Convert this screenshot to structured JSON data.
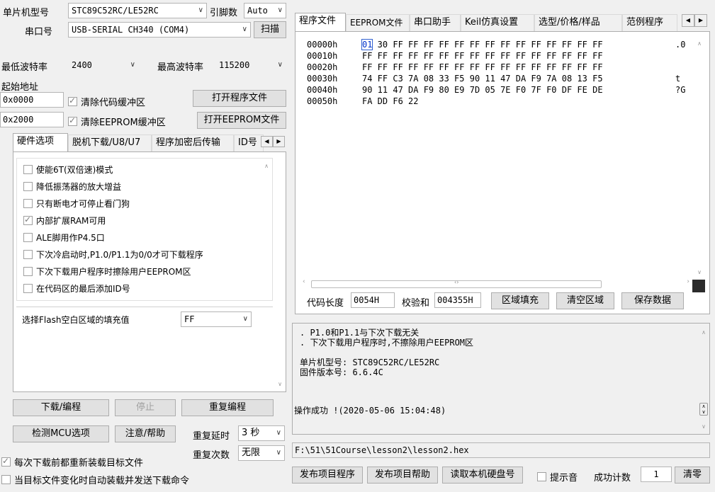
{
  "mcu": {
    "label": "单片机型号",
    "value": "STC89C52RC/LE52RC",
    "pin_label": "引脚数",
    "pin_value": "Auto"
  },
  "port": {
    "label": "串口号",
    "value": "USB-SERIAL CH340 (COM4)",
    "scan_label": "扫描"
  },
  "baud": {
    "min_label": "最低波特率",
    "min_value": "2400",
    "max_label": "最高波特率",
    "max_value": "115200"
  },
  "start_addr": {
    "label": "起始地址",
    "addr1": "0x0000",
    "clear_code": "清除代码缓冲区",
    "open_prog": "打开程序文件",
    "addr2": "0x2000",
    "clear_eeprom": "清除EEPROM缓冲区",
    "open_eeprom": "打开EEPROM文件"
  },
  "left_tabs": [
    "硬件选项",
    "脱机下载/U8/U7",
    "程序加密后传输",
    "ID号"
  ],
  "hw_options": [
    {
      "label": "使能6T(双倍速)模式",
      "checked": false
    },
    {
      "label": "降低振荡器的放大增益",
      "checked": false
    },
    {
      "label": "只有断电才可停止看门狗",
      "checked": false
    },
    {
      "label": "内部扩展RAM可用",
      "checked": true
    },
    {
      "label": "ALE脚用作P4.5口",
      "checked": false
    },
    {
      "label": "下次冷启动时,P1.0/P1.1为0/0才可下载程序",
      "checked": false
    },
    {
      "label": "下次下载用户程序时擦除用户EEPROM区",
      "checked": false
    },
    {
      "label": "在代码区的最后添加ID号",
      "checked": false
    }
  ],
  "fill": {
    "label": "选择Flash空白区域的填充值",
    "value": "FF"
  },
  "actions": {
    "download": "下载/编程",
    "stop": "停止",
    "repeat": "重复编程",
    "detect": "检测MCU选项",
    "help": "注意/帮助",
    "delay_label": "重复延时",
    "delay_value": "3 秒",
    "count_label": "重复次数",
    "count_value": "无限"
  },
  "bottom_checks": {
    "reload": "每次下载前都重新装载目标文件",
    "auto": "当目标文件变化时自动装载并发送下载命令",
    "reload_checked": true,
    "auto_checked": false
  },
  "right_tabs": [
    "程序文件",
    "EEPROM文件",
    "串口助手",
    "Keil仿真设置",
    "选型/价格/样品",
    "范例程序"
  ],
  "hex": {
    "rows": [
      {
        "addr": "00000h",
        "bytes": "01 30 FF FF FF FF FF FF FF FF FF FF FF FF FF FF",
        "ascii": ".0"
      },
      {
        "addr": "00010h",
        "bytes": "FF FF FF FF FF FF FF FF FF FF FF FF FF FF FF FF",
        "ascii": ""
      },
      {
        "addr": "00020h",
        "bytes": "FF FF FF FF FF FF FF FF FF FF FF FF FF FF FF FF",
        "ascii": ""
      },
      {
        "addr": "00030h",
        "bytes": "74 FF C3 7A 08 33 F5 90 11 47 DA F9 7A 08 13 F5",
        "ascii": "t"
      },
      {
        "addr": "00040h",
        "bytes": "90 11 47 DA F9 80 E9 7D 05 7E F0 7F F0 DF FE DE",
        "ascii": "?G"
      },
      {
        "addr": "00050h",
        "bytes": "FA DD F6 22",
        "ascii": ""
      }
    ]
  },
  "code_info": {
    "len_label": "代码长度",
    "len_value": "0054H",
    "sum_label": "校验和",
    "sum_value": "004355H",
    "fill_btn": "区域填充",
    "clear_btn": "清空区域",
    "save_btn": "保存数据"
  },
  "log": {
    "lines": [
      ". P1.0和P1.1与下次下载无关",
      ". 下次下载用户程序时,不擦除用户EEPROM区",
      "",
      "单片机型号: STC89C52RC/LE52RC",
      "固件版本号: 6.6.4C"
    ],
    "status": "操作成功 !(2020-05-06 15:04:48)"
  },
  "file_path": "F:\\51\\51Course\\lesson2\\lesson2.hex",
  "footer": {
    "pub_prog": "发布项目程序",
    "pub_help": "发布项目帮助",
    "read_disk": "读取本机硬盘号",
    "sound": "提示音",
    "sound_checked": false,
    "count_label": "成功计数",
    "count_value": "1",
    "clear": "清零"
  }
}
